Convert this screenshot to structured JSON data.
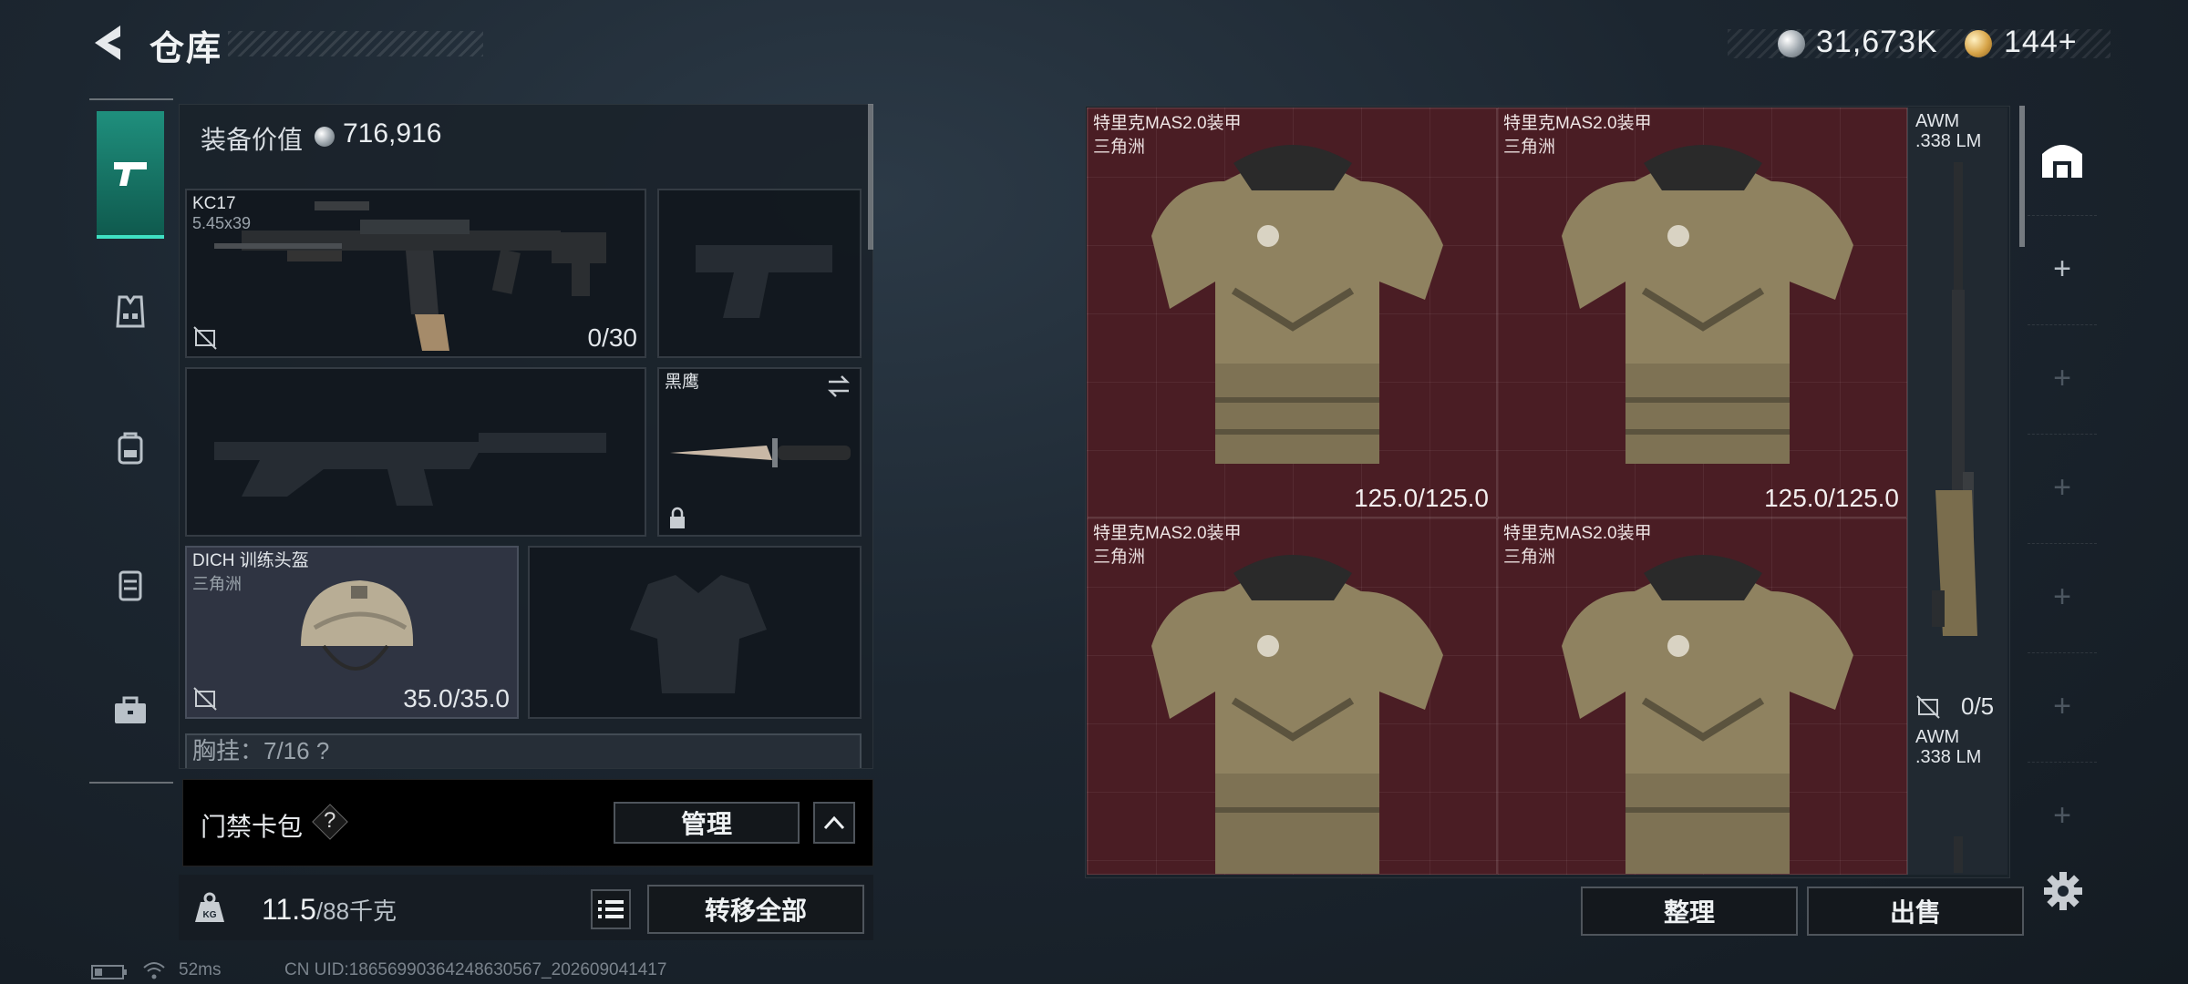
{
  "header": {
    "title": "仓库",
    "currency_silver": "31,673K",
    "currency_gold": "144+"
  },
  "rail": {
    "items": [
      {
        "name": "weapons",
        "icon": "pistol-icon",
        "active": true
      },
      {
        "name": "vest",
        "icon": "vest-icon",
        "active": false
      },
      {
        "name": "backpack",
        "icon": "backpack-icon",
        "active": false
      },
      {
        "name": "chest-rig",
        "icon": "rig-icon",
        "active": false
      },
      {
        "name": "case",
        "icon": "briefcase-icon",
        "active": false
      }
    ]
  },
  "equipment": {
    "value_label": "装备价值",
    "value": "716,916",
    "primary_weapon": {
      "name": "KC17",
      "caliber": "5.45x39",
      "ammo": "0/30"
    },
    "melee": {
      "name": "黑鹰"
    },
    "helmet": {
      "name": "DICH 训练头盔",
      "source": "三角洲",
      "durability": "35.0/35.0"
    },
    "chest_rig_peek": "胸挂：7/16  ?"
  },
  "card_pack": {
    "label": "门禁卡包",
    "help": "?",
    "manage_label": "管理"
  },
  "weight": {
    "current": "11.5",
    "max": "/88千克"
  },
  "transfer_all_label": "转移全部",
  "storage": {
    "vests": [
      {
        "name": "特里克MAS2.0装甲",
        "source": "三角洲",
        "durability": "125.0/125.0"
      },
      {
        "name": "特里克MAS2.0装甲",
        "source": "三角洲",
        "durability": "125.0/125.0"
      },
      {
        "name": "特里克MAS2.0装甲",
        "source": "三角洲",
        "durability": ""
      },
      {
        "name": "特里克MAS2.0装甲",
        "source": "三角洲",
        "durability": ""
      }
    ],
    "rifles": [
      {
        "name": "AWM",
        "ammo_type": ".338 LM",
        "count": "0/5"
      },
      {
        "name": "AWM",
        "ammo_type": ".338 LM",
        "count": ""
      }
    ]
  },
  "actions": {
    "sort_label": "整理",
    "sell_label": "出售"
  },
  "status_bar": {
    "ping": "52ms",
    "uid": "CN UID:18656990364248630567_202609041417"
  },
  "colors": {
    "accent": "#1f8f7d",
    "vest_bg": "#4a1d24",
    "panel": "#1a222a"
  }
}
